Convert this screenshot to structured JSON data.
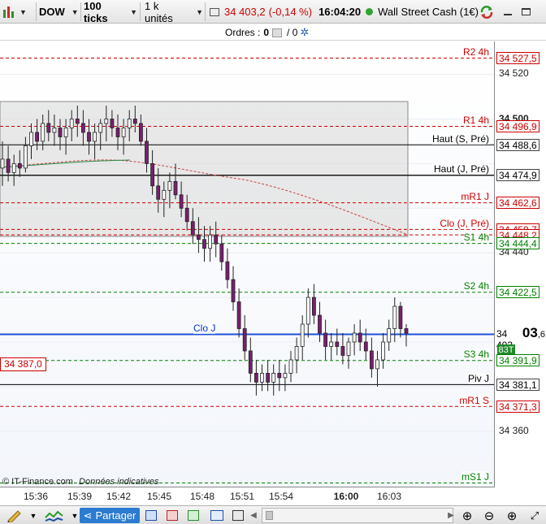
{
  "toolbar": {
    "instrument": "DOW",
    "ticks": "100 ticks",
    "units": "1 k unités",
    "price": "34 403,2",
    "change": "(-0,14 %)",
    "time": "16:04:20",
    "market_name": "Wall Street Cash (1€)"
  },
  "orders": {
    "label": "Ordres :",
    "count1": "0",
    "count2": "/ 0"
  },
  "price_axis": {
    "ticks": [
      "34 520",
      "34 500",
      "34 440",
      "34 360"
    ],
    "current_price_main": "34 403",
    "current_price_big": ",6",
    "current_volume": "83T"
  },
  "levels": [
    {
      "name": "R2 4h",
      "price": "34 527,5",
      "color": "#cc0000"
    },
    {
      "name": "R1 4h",
      "price": "34 496,9",
      "color": "#cc0000"
    },
    {
      "name": "Haut (S, Pré)",
      "price": "34 488,6",
      "color": "#000000"
    },
    {
      "name": "Haut (J, Pré)",
      "price": "34 475,0",
      "color": "#000000"
    },
    {
      "name": "",
      "price": "34 474,9",
      "color": "#000000"
    },
    {
      "name": "mR1 J",
      "price": "34 462,6",
      "color": "#cc0000"
    },
    {
      "name": "Clo (J, Pré)",
      "price": "34 450,7",
      "color": "#cc0000"
    },
    {
      "name": "",
      "price": "34 448,2",
      "color": "#cc0000"
    },
    {
      "name": "S1 4h",
      "price": "34 444,4",
      "color": "#008000"
    },
    {
      "name": "S2 4h",
      "price": "34 422,5",
      "color": "#008000"
    },
    {
      "name": "Clo J",
      "price": "",
      "color": "#0033cc"
    },
    {
      "name": "S3 4h",
      "price": "34 391,9",
      "color": "#008000"
    },
    {
      "name": "Piv J",
      "price": "34 381,1",
      "color": "#000000"
    },
    {
      "name": "mR1 S",
      "price": "34 371,3",
      "color": "#cc0000"
    },
    {
      "name": "mS1 J",
      "price": "",
      "color": "#008000"
    }
  ],
  "left_price_label": "34 387,0",
  "time_axis": [
    "15:36",
    "15:39",
    "15:42",
    "15:45",
    "15:48",
    "15:51",
    "15:54",
    "16:00",
    "16:03"
  ],
  "copyright": "© IT-Finance.com",
  "disclaimer": "Données indicatives",
  "bottombar": {
    "share_label": "Partager"
  },
  "chart_data": {
    "type": "candlestick",
    "y_scale_note": "price",
    "ylim": [
      34345,
      34545
    ],
    "candles": [
      [
        34478,
        34490,
        34470,
        34482
      ],
      [
        34482,
        34488,
        34472,
        34476
      ],
      [
        34476,
        34484,
        34470,
        34480
      ],
      [
        34480,
        34486,
        34474,
        34478
      ],
      [
        34478,
        34492,
        34476,
        34488
      ],
      [
        34488,
        34498,
        34482,
        34494
      ],
      [
        34494,
        34500,
        34486,
        34490
      ],
      [
        34490,
        34502,
        34486,
        34498
      ],
      [
        34498,
        34504,
        34490,
        34494
      ],
      [
        34494,
        34502,
        34488,
        34496
      ],
      [
        34496,
        34500,
        34486,
        34492
      ],
      [
        34492,
        34500,
        34484,
        34496
      ],
      [
        34496,
        34504,
        34490,
        34500
      ],
      [
        34500,
        34506,
        34492,
        34498
      ],
      [
        34498,
        34504,
        34488,
        34494
      ],
      [
        34494,
        34500,
        34484,
        34490
      ],
      [
        34490,
        34498,
        34482,
        34494
      ],
      [
        34494,
        34500,
        34486,
        34498
      ],
      [
        34498,
        34506,
        34490,
        34500
      ],
      [
        34500,
        34504,
        34492,
        34496
      ],
      [
        34496,
        34502,
        34486,
        34492
      ],
      [
        34492,
        34500,
        34484,
        34496
      ],
      [
        34496,
        34504,
        34490,
        34500
      ],
      [
        34500,
        34506,
        34494,
        34498
      ],
      [
        34498,
        34502,
        34488,
        34490
      ],
      [
        34490,
        34496,
        34476,
        34480
      ],
      [
        34480,
        34486,
        34466,
        34470
      ],
      [
        34470,
        34478,
        34458,
        34464
      ],
      [
        34464,
        34472,
        34456,
        34468
      ],
      [
        34468,
        34476,
        34460,
        34472
      ],
      [
        34472,
        34480,
        34464,
        34466
      ],
      [
        34466,
        34472,
        34456,
        34460
      ],
      [
        34460,
        34466,
        34450,
        34454
      ],
      [
        34454,
        34460,
        34444,
        34448
      ],
      [
        34448,
        34456,
        34440,
        34446
      ],
      [
        34446,
        34452,
        34436,
        34442
      ],
      [
        34442,
        34452,
        34436,
        34448
      ],
      [
        34448,
        34454,
        34438,
        34444
      ],
      [
        34444,
        34448,
        34432,
        34436
      ],
      [
        34436,
        34442,
        34424,
        34428
      ],
      [
        34428,
        34434,
        34414,
        34418
      ],
      [
        34418,
        34424,
        34402,
        34406
      ],
      [
        34406,
        34412,
        34392,
        34396
      ],
      [
        34396,
        34402,
        34382,
        34386
      ],
      [
        34386,
        34392,
        34376,
        34382
      ],
      [
        34382,
        34390,
        34378,
        34386
      ],
      [
        34386,
        34392,
        34378,
        34382
      ],
      [
        34382,
        34390,
        34376,
        34386
      ],
      [
        34386,
        34392,
        34378,
        34384
      ],
      [
        34384,
        34390,
        34378,
        34386
      ],
      [
        34386,
        34396,
        34382,
        34392
      ],
      [
        34392,
        34402,
        34386,
        34398
      ],
      [
        34398,
        34412,
        34392,
        34408
      ],
      [
        34408,
        34424,
        34402,
        34420
      ],
      [
        34420,
        34426,
        34408,
        34412
      ],
      [
        34412,
        34418,
        34400,
        34404
      ],
      [
        34404,
        34410,
        34392,
        34398
      ],
      [
        34398,
        34404,
        34392,
        34400
      ],
      [
        34400,
        34406,
        34394,
        34398
      ],
      [
        34398,
        34404,
        34390,
        34394
      ],
      [
        34394,
        34402,
        34388,
        34400
      ],
      [
        34400,
        34408,
        34394,
        34404
      ],
      [
        34404,
        34410,
        34396,
        34400
      ],
      [
        34400,
        34406,
        34392,
        34396
      ],
      [
        34396,
        34402,
        34384,
        34388
      ],
      [
        34388,
        34396,
        34380,
        34392
      ],
      [
        34392,
        34404,
        34388,
        34400
      ],
      [
        34400,
        34410,
        34396,
        34406
      ],
      [
        34406,
        34420,
        34400,
        34416
      ],
      [
        34416,
        34418,
        34402,
        34406
      ],
      [
        34406,
        34408,
        34398,
        34404
      ]
    ]
  }
}
